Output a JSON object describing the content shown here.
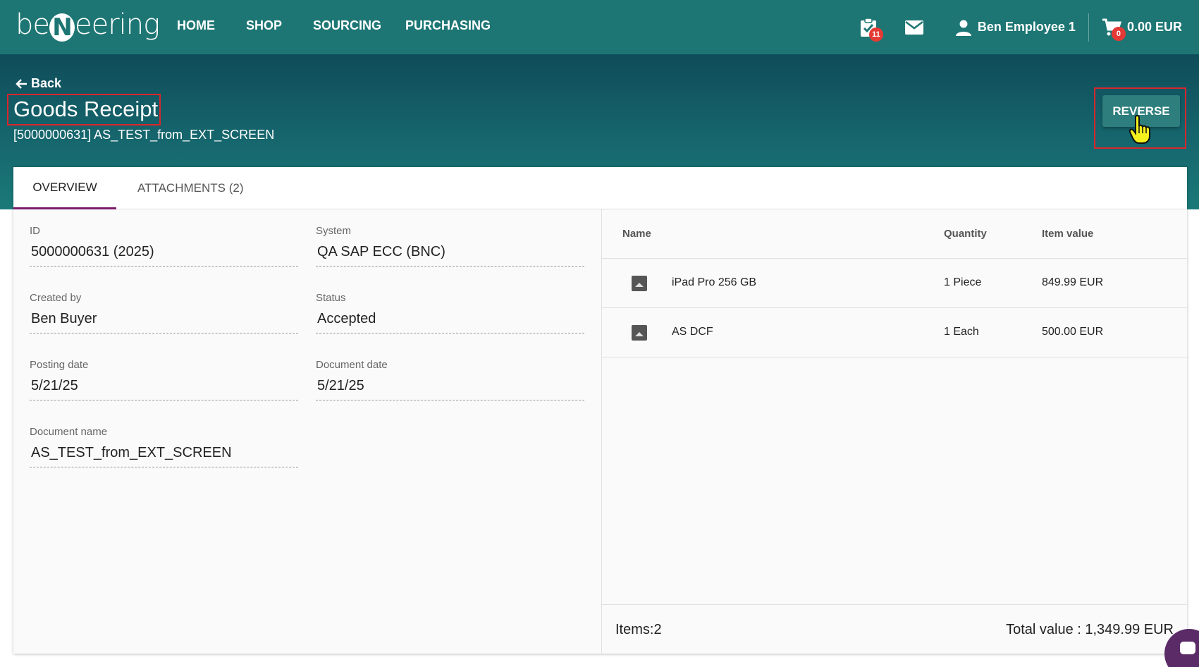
{
  "brand": {
    "logo_prefix": "be",
    "logo_n": "N",
    "logo_suffix": "eering"
  },
  "nav": {
    "items": [
      "HOME",
      "SHOP",
      "SOURCING",
      "PURCHASING"
    ]
  },
  "header_right": {
    "tasks_badge": "11",
    "user_name": "Ben Employee 1",
    "cart_badge": "0",
    "cart_total": "0.00 EUR"
  },
  "page": {
    "back_label": "Back",
    "title": "Goods Receipt",
    "subtitle": "[5000000631] AS_TEST_from_EXT_SCREEN",
    "reverse_label": "REVERSE"
  },
  "tabs": [
    {
      "label": "OVERVIEW"
    },
    {
      "label": "ATTACHMENTS (2)"
    }
  ],
  "fields": {
    "id": {
      "label": "ID",
      "value": "5000000631 (2025)"
    },
    "system": {
      "label": "System",
      "value": "QA SAP ECC (BNC)"
    },
    "created_by": {
      "label": "Created by",
      "value": "Ben Buyer"
    },
    "status": {
      "label": "Status",
      "value": "Accepted"
    },
    "posting_date": {
      "label": "Posting date",
      "value": "5/21/25"
    },
    "document_date": {
      "label": "Document date",
      "value": "5/21/25"
    },
    "document_name": {
      "label": "Document name",
      "value": "AS_TEST_from_EXT_SCREEN"
    }
  },
  "items_table": {
    "columns": [
      "Name",
      "Quantity",
      "Item value"
    ],
    "rows": [
      {
        "name": "iPad Pro 256 GB",
        "quantity": "1 Piece",
        "value": "849.99 EUR"
      },
      {
        "name": "AS DCF",
        "quantity": "1 Each",
        "value": "500.00 EUR"
      }
    ],
    "items_count": "Items:2",
    "total_value": "Total value : 1,349.99 EUR"
  },
  "colors": {
    "topbar": "#1d7674",
    "tab_indicator": "#7b1b6a",
    "highlight_border": "#d9262c",
    "badge": "#e53935"
  }
}
